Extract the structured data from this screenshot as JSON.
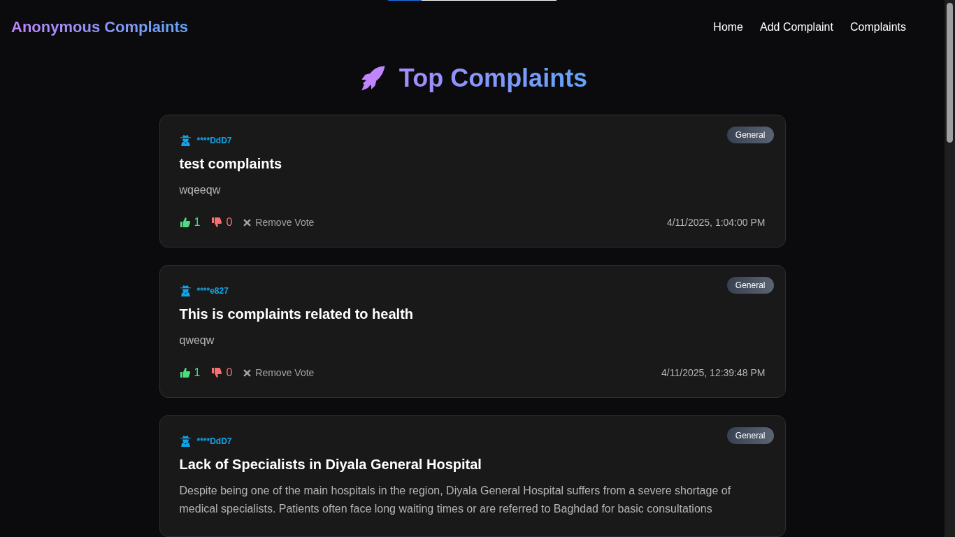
{
  "brand": "Anonymous Complaints",
  "nav": [
    {
      "label": "Home"
    },
    {
      "label": "Add Complaint"
    },
    {
      "label": "Complaints"
    }
  ],
  "heading": "Top Complaints",
  "complaints": [
    {
      "author": "****DdD7",
      "category": "General",
      "title": "test complaints",
      "body": "wqeeqw",
      "footer": {
        "upvotes": "1",
        "downvotes": "0",
        "remove_vote": "Remove Vote",
        "date": "4/11/2025, 1:04:00 PM"
      }
    },
    {
      "author": "****e827",
      "category": "General",
      "title": "This is complaints related to health",
      "body": "qweqw",
      "footer": {
        "upvotes": "1",
        "downvotes": "0",
        "remove_vote": "Remove Vote",
        "date": "4/11/2025, 12:39:48 PM"
      }
    },
    {
      "author": "****DdD7",
      "category": "General",
      "title": "Lack of Specialists in Diyala General Hospital",
      "body": "Despite being one of the main hospitals in the region, Diyala General Hospital suffers from a severe shortage of medical specialists. Patients often face long waiting times or are referred to Baghdad for basic consultations"
    }
  ]
}
